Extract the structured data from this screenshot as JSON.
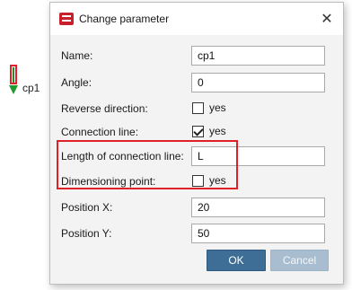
{
  "canvas": {
    "label": "cp1"
  },
  "dialog": {
    "title": "Change parameter",
    "fields": {
      "name": {
        "label": "Name:",
        "value": "cp1"
      },
      "angle": {
        "label": "Angle:",
        "value": "0"
      },
      "reverse_direction": {
        "label": "Reverse direction:",
        "checkbox_label": "yes",
        "checked": false
      },
      "connection_line": {
        "label": "Connection line:",
        "checkbox_label": "yes",
        "checked": true
      },
      "length_connection_line": {
        "label": "Length of connection line:",
        "value": "L"
      },
      "dimensioning_point": {
        "label": "Dimensioning point:",
        "checkbox_label": "yes",
        "checked": false
      },
      "position_x": {
        "label": "Position X:",
        "value": "20"
      },
      "position_y": {
        "label": "Position Y:",
        "value": "50"
      }
    },
    "buttons": {
      "ok": "OK",
      "cancel": "Cancel"
    }
  },
  "colors": {
    "highlight": "#e02028",
    "ok_button": "#3e6e95",
    "cancel_button": "#a8bdcf",
    "marker_arrow": "#1f9a2c"
  }
}
